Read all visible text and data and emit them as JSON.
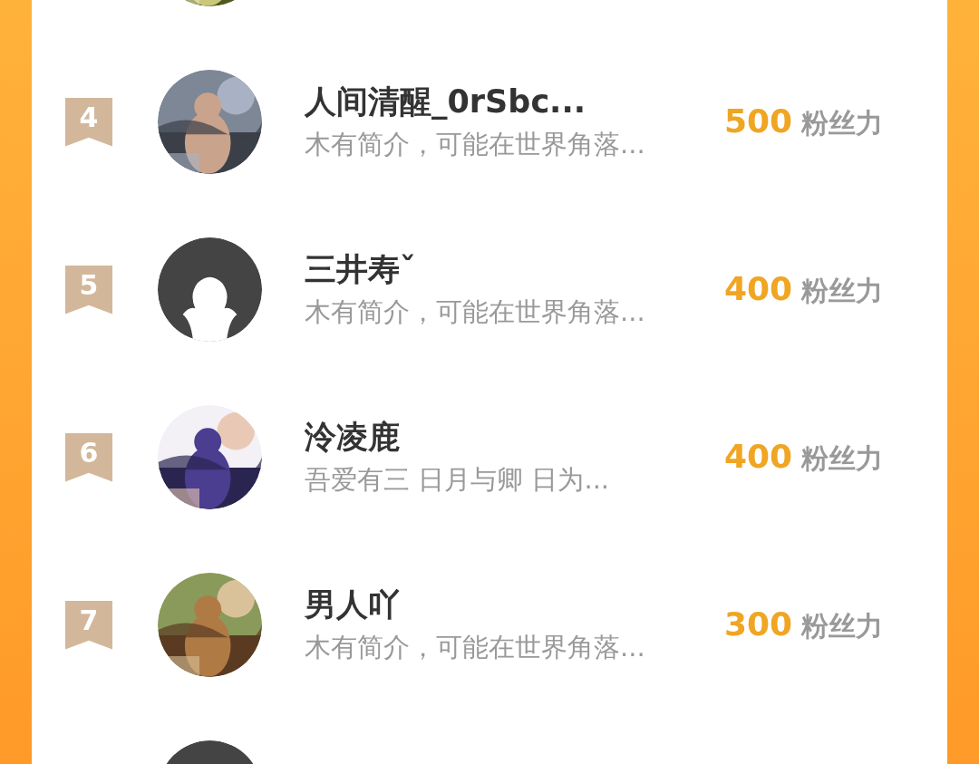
{
  "ranking": [
    {
      "avatar": {
        "kind": "picture"
      }
    },
    {
      "rank": "4",
      "avatar": {
        "kind": "picture"
      },
      "name": "人间清醒_0rSbc...",
      "bio": "木有简介，可能在世界角落...",
      "score": "500",
      "unit": "粉丝力"
    },
    {
      "rank": "5",
      "avatar": {
        "kind": "default"
      },
      "name": "三井寿ˇ",
      "bio": "木有简介，可能在世界角落...",
      "score": "400",
      "unit": "粉丝力"
    },
    {
      "rank": "6",
      "avatar": {
        "kind": "picture"
      },
      "name": "泠凌鹿",
      "bio": "吾爱有三 日月与卿 日为...",
      "score": "400",
      "unit": "粉丝力"
    },
    {
      "rank": "7",
      "avatar": {
        "kind": "picture"
      },
      "name": "男人吖",
      "bio": "木有简介，可能在世界角落...",
      "score": "300",
      "unit": "粉丝力"
    },
    {
      "avatar": {
        "kind": "default"
      }
    }
  ]
}
